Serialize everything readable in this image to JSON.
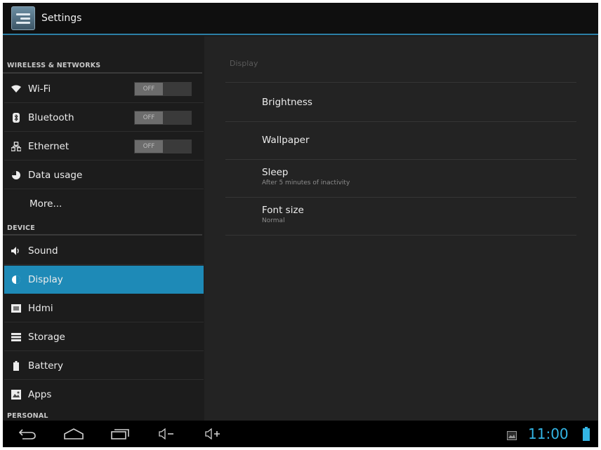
{
  "window": {
    "title": "Settings",
    "icon": "settings-app-icon"
  },
  "sidebar": {
    "sections": [
      {
        "header": "WIRELESS & NETWORKS"
      },
      {
        "header": "DEVICE"
      },
      {
        "header": "PERSONAL"
      }
    ],
    "items": [
      {
        "label": "Wi-Fi",
        "icon": "wifi-icon",
        "toggle": "OFF"
      },
      {
        "label": "Bluetooth",
        "icon": "bluetooth-icon",
        "toggle": "OFF"
      },
      {
        "label": "Ethernet",
        "icon": "ethernet-icon",
        "toggle": "OFF"
      },
      {
        "label": "Data usage",
        "icon": "data-usage-icon"
      },
      {
        "label": "More..."
      },
      {
        "label": "Sound",
        "icon": "speaker-icon"
      },
      {
        "label": "Display",
        "icon": "display-icon",
        "selected": true
      },
      {
        "label": "Hdmi",
        "icon": "hdmi-icon"
      },
      {
        "label": "Storage",
        "icon": "storage-icon"
      },
      {
        "label": "Battery",
        "icon": "battery-icon"
      },
      {
        "label": "Apps",
        "icon": "apps-icon"
      }
    ]
  },
  "detail": {
    "title": "Display",
    "preferences": [
      {
        "title": "Brightness",
        "summary": ""
      },
      {
        "title": "Wallpaper",
        "summary": ""
      },
      {
        "title": "Sleep",
        "summary": "After 5 minutes of inactivity"
      },
      {
        "title": "Font size",
        "summary": "Normal"
      }
    ]
  },
  "systembar": {
    "time": "11:00",
    "nav_icons": [
      "back-icon",
      "home-icon",
      "recent-apps-icon",
      "volume-down-icon",
      "volume-up-icon"
    ],
    "status_icons": [
      "screenshot-icon",
      "battery-status-icon"
    ],
    "accent_color": "#33b5e5"
  },
  "colors": {
    "selected": "#1e8ab7",
    "actionbar_rule": "#2c7fa6"
  }
}
